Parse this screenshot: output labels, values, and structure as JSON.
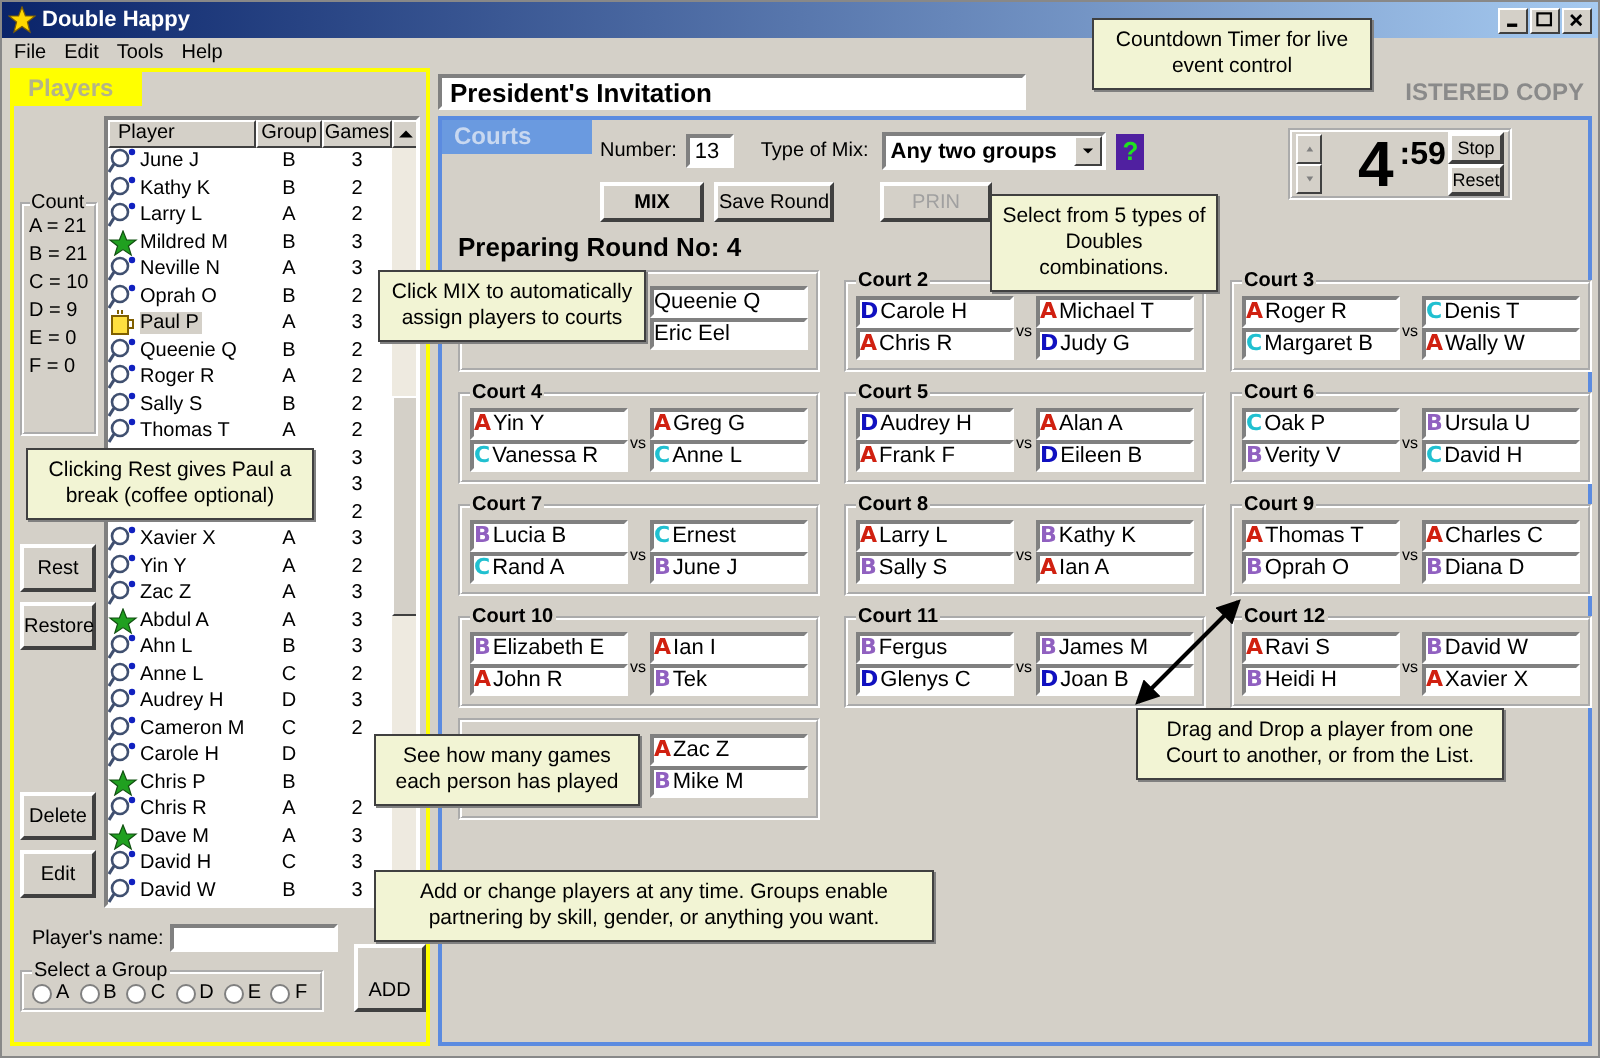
{
  "window": {
    "title": "Double Happy"
  },
  "menu": [
    "File",
    "Edit",
    "Tools",
    "Help"
  ],
  "players_panel": {
    "title": "Players",
    "list": {
      "columns": [
        "Player",
        "Group",
        "Games"
      ],
      "rows": [
        {
          "kind": "racket",
          "name": "June J",
          "group": "B",
          "games": "3",
          "selected": false
        },
        {
          "kind": "racket",
          "name": "Kathy K",
          "group": "B",
          "games": "2",
          "selected": false
        },
        {
          "kind": "racket",
          "name": "Larry L",
          "group": "A",
          "games": "2",
          "selected": false
        },
        {
          "kind": "star",
          "name": "Mildred M",
          "group": "B",
          "games": "3",
          "selected": false
        },
        {
          "kind": "racket",
          "name": "Neville N",
          "group": "A",
          "games": "3",
          "selected": false
        },
        {
          "kind": "racket",
          "name": "Oprah O",
          "group": "B",
          "games": "2",
          "selected": false
        },
        {
          "kind": "coffee",
          "name": "Paul P",
          "group": "A",
          "games": "3",
          "selected": true
        },
        {
          "kind": "racket",
          "name": "Queenie Q",
          "group": "B",
          "games": "2",
          "selected": false
        },
        {
          "kind": "racket",
          "name": "Roger R",
          "group": "A",
          "games": "2",
          "selected": false
        },
        {
          "kind": "racket",
          "name": "Sally S",
          "group": "B",
          "games": "2",
          "selected": false
        },
        {
          "kind": "racket",
          "name": "Thomas T",
          "group": "A",
          "games": "2",
          "selected": false
        },
        {
          "games": "3",
          "selected": false
        },
        {
          "games": "3",
          "selected": false
        },
        {
          "games": "2",
          "selected": false
        },
        {
          "kind": "racket",
          "name": "Xavier X",
          "group": "A",
          "games": "3",
          "selected": false
        },
        {
          "kind": "racket",
          "name": "Yin Y",
          "group": "A",
          "games": "2",
          "selected": false
        },
        {
          "kind": "racket",
          "name": "Zac Z",
          "group": "A",
          "games": "3",
          "selected": false
        },
        {
          "kind": "star",
          "name": "Abdul A",
          "group": "A",
          "games": "3",
          "selected": false
        },
        {
          "kind": "racket",
          "name": "Ahn L",
          "group": "B",
          "games": "3",
          "selected": false
        },
        {
          "kind": "racket",
          "name": "Anne L",
          "group": "C",
          "games": "2",
          "selected": false
        },
        {
          "kind": "racket",
          "name": "Audrey H",
          "group": "D",
          "games": "3",
          "selected": false
        },
        {
          "kind": "racket",
          "name": "Cameron M",
          "group": "C",
          "games": "2",
          "selected": false
        },
        {
          "kind": "racket",
          "name": "Carole H",
          "group": "D",
          "selected": false
        },
        {
          "kind": "star",
          "name": "Chris P",
          "group": "B",
          "selected": false
        },
        {
          "kind": "racket",
          "name": "Chris R",
          "group": "A",
          "games": "2",
          "selected": false
        },
        {
          "kind": "star",
          "name": "Dave M",
          "group": "A",
          "games": "3",
          "selected": false
        },
        {
          "kind": "racket",
          "name": "David H",
          "group": "C",
          "games": "3",
          "selected": false
        },
        {
          "kind": "racket",
          "name": "David W",
          "group": "B",
          "games": "3",
          "selected": false
        }
      ]
    },
    "count": {
      "title": "Count",
      "items": [
        "A = 21",
        "B = 21",
        "C = 10",
        "D = 9",
        "E = 0",
        "F = 0"
      ]
    },
    "buttons": [
      "Rest",
      "Restore",
      "Delete",
      "Edit"
    ],
    "name_field": {
      "label": "Player's name:"
    },
    "group_select": {
      "title": "Select a Group",
      "options": [
        {
          "label": "A",
          "selected": false
        },
        {
          "label": "B",
          "selected": false
        },
        {
          "label": "C",
          "selected": false
        },
        {
          "label": "D",
          "selected": false
        },
        {
          "label": "E",
          "selected": false
        },
        {
          "label": "F",
          "selected": false
        }
      ]
    },
    "add_button": "ADD"
  },
  "event_title": "President's Invitation",
  "registration": "ISTERED COPY",
  "courts_panel": {
    "title": "Courts",
    "number_label": "Number:",
    "number": "13",
    "mix_label": "Type of Mix:",
    "mix_value": "Any two groups",
    "help_button": "?",
    "buttons": [
      {
        "label": "MIX",
        "disabled": false
      },
      {
        "label": "Save Round",
        "disabled": false
      },
      {
        "label": "PRIN",
        "disabled": true
      }
    ],
    "timer": {
      "minutes": "4",
      "seconds": ":59",
      "buttons": [
        "Stop",
        "Reset"
      ]
    },
    "round_heading": "Preparing Round No: 4",
    "courts": [
      {
        "right_team": [
          {
            "name": "Queenie Q"
          },
          {
            "name": "Eric Eel"
          }
        ]
      },
      {
        "title": "Court 2",
        "vs": "vs",
        "left_team": [
          {
            "group": "D",
            "color": "#1010c0",
            "name": "Carole H"
          },
          {
            "group": "A",
            "color": "#d02010",
            "name": "Chris R"
          }
        ],
        "right_team": [
          {
            "group": "A",
            "color": "#d02010",
            "name": "Michael T"
          },
          {
            "group": "D",
            "color": "#1010c0",
            "name": "Judy G"
          }
        ]
      },
      {
        "title": "Court 3",
        "vs": "vs",
        "left_team": [
          {
            "group": "A",
            "color": "#d02010",
            "name": "Roger R"
          },
          {
            "group": "C",
            "color": "#20c0d0",
            "name": "Margaret B"
          }
        ],
        "right_team": [
          {
            "group": "C",
            "color": "#20c0d0",
            "name": "Denis T"
          },
          {
            "group": "A",
            "color": "#d02010",
            "name": "Wally W"
          }
        ]
      },
      {
        "title": "Court 4",
        "vs": "vs",
        "left_team": [
          {
            "group": "A",
            "color": "#d02010",
            "name": "Yin Y"
          },
          {
            "group": "C",
            "color": "#20c0d0",
            "name": "Vanessa R"
          }
        ],
        "right_team": [
          {
            "group": "A",
            "color": "#d02010",
            "name": "Greg G"
          },
          {
            "group": "C",
            "color": "#20c0d0",
            "name": "Anne L"
          }
        ]
      },
      {
        "title": "Court 5",
        "vs": "vs",
        "left_team": [
          {
            "group": "D",
            "color": "#1010c0",
            "name": "Audrey H"
          },
          {
            "group": "A",
            "color": "#d02010",
            "name": "Frank F"
          }
        ],
        "right_team": [
          {
            "group": "A",
            "color": "#d02010",
            "name": "Alan A"
          },
          {
            "group": "D",
            "color": "#1010c0",
            "name": "Eileen B"
          }
        ]
      },
      {
        "title": "Court 6",
        "vs": "vs",
        "left_team": [
          {
            "group": "C",
            "color": "#20c0d0",
            "name": "Oak P"
          },
          {
            "group": "B",
            "color": "#9060c0",
            "name": "Verity V"
          }
        ],
        "right_team": [
          {
            "group": "B",
            "color": "#9060c0",
            "name": "Ursula U"
          },
          {
            "group": "C",
            "color": "#20c0d0",
            "name": "David H"
          }
        ]
      },
      {
        "title": "Court 7",
        "vs": "vs",
        "left_team": [
          {
            "group": "B",
            "color": "#9060c0",
            "name": "Lucia B"
          },
          {
            "group": "C",
            "color": "#20c0d0",
            "name": "Rand A"
          }
        ],
        "right_team": [
          {
            "group": "C",
            "color": "#20c0d0",
            "name": "Ernest"
          },
          {
            "group": "B",
            "color": "#9060c0",
            "name": "June J"
          }
        ]
      },
      {
        "title": "Court 8",
        "vs": "vs",
        "left_team": [
          {
            "group": "A",
            "color": "#d02010",
            "name": "Larry L"
          },
          {
            "group": "B",
            "color": "#9060c0",
            "name": "Sally S"
          }
        ],
        "right_team": [
          {
            "group": "B",
            "color": "#9060c0",
            "name": "Kathy K"
          },
          {
            "group": "A",
            "color": "#d02010",
            "name": "Ian A"
          }
        ]
      },
      {
        "title": "Court 9",
        "vs": "vs",
        "left_team": [
          {
            "group": "A",
            "color": "#d02010",
            "name": "Thomas T"
          },
          {
            "group": "B",
            "color": "#9060c0",
            "name": "Oprah O"
          }
        ],
        "right_team": [
          {
            "group": "A",
            "color": "#d02010",
            "name": "Charles C"
          },
          {
            "group": "B",
            "color": "#9060c0",
            "name": "Diana D"
          }
        ]
      },
      {
        "title": "Court 10",
        "vs": "vs",
        "left_team": [
          {
            "group": "B",
            "color": "#9060c0",
            "name": "Elizabeth E"
          },
          {
            "group": "A",
            "color": "#d02010",
            "name": "John R"
          }
        ],
        "right_team": [
          {
            "group": "A",
            "color": "#d02010",
            "name": "Ian I"
          },
          {
            "group": "B",
            "color": "#9060c0",
            "name": "Tek"
          }
        ]
      },
      {
        "title": "Court 11",
        "vs": "vs",
        "left_team": [
          {
            "group": "B",
            "color": "#9060c0",
            "name": "Fergus"
          },
          {
            "group": "D",
            "color": "#1010c0",
            "name": "Glenys C"
          }
        ],
        "right_team": [
          {
            "group": "B",
            "color": "#9060c0",
            "name": "James M"
          },
          {
            "group": "D",
            "color": "#1010c0",
            "name": "Joan B"
          }
        ]
      },
      {
        "title": "Court 12",
        "vs": "vs",
        "left_team": [
          {
            "group": "A",
            "color": "#d02010",
            "name": "Ravi S"
          },
          {
            "group": "B",
            "color": "#9060c0",
            "name": "Heidi H"
          }
        ],
        "right_team": [
          {
            "group": "B",
            "color": "#9060c0",
            "name": "David W"
          },
          {
            "group": "A",
            "color": "#d02010",
            "name": "Xavier X"
          }
        ]
      },
      {
        "right_team": [
          {
            "group": "A",
            "color": "#d02010",
            "name": "Zac Z"
          },
          {
            "group": "B",
            "color": "#9060c0",
            "name": "Mike M"
          }
        ]
      }
    ]
  },
  "callouts": [
    "Countdown Timer for live event control",
    "Click MIX to automatically assign players to courts",
    "Select from 5 types of Doubles combinations.",
    "Clicking Rest gives Paul a break (coffee optional)",
    "See how many games each person has played",
    "Drag and Drop a player from one Court to another, or from the List.",
    "Add or change players at any time. Groups enable partnering by skill, gender, or anything you want."
  ]
}
